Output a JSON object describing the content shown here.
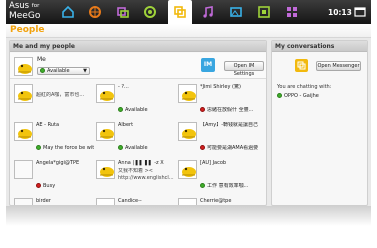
{
  "brand": {
    "line1": "Asus",
    "line1_small": "for",
    "line2": "MeeGo"
  },
  "zones": [
    "home-icon",
    "status-icon",
    "people-icon",
    "games-icon",
    "people-icon",
    "music-icon",
    "photos-icon",
    "web-icon",
    "apps-icon"
  ],
  "clock": "10:13",
  "page_title": "People",
  "left_panel": {
    "title": "Me and my people",
    "me": {
      "name": "Me",
      "status": "Available",
      "open_im_button": "Open IM Settings"
    },
    "contacts": [
      {
        "name": "",
        "message": "超紅的A咖，富市也...",
        "status": "",
        "status_type": "none",
        "avatar": "dino"
      },
      {
        "name": "- ?...",
        "message": "",
        "status": "Available",
        "status_type": "available",
        "avatar": "dino"
      },
      {
        "name": "*Jimi   Shirley (驚)",
        "message": "",
        "status": "思緒在放假什 全豐...",
        "status_type": "busy",
        "avatar": "dino"
      },
      {
        "name": "AE - Ruta",
        "message": "",
        "status": "May the force be wit...",
        "status_type": "available",
        "avatar": "dino"
      },
      {
        "name": "Albert",
        "message": "",
        "status": "Available",
        "status_type": "available",
        "avatar": "dino"
      },
      {
        "name": "【Amy】-轉钱就是讓自己最快找長的捷楼~",
        "message": "",
        "status": "可能要是湖AMA看過要...",
        "status_type": "busy",
        "avatar": "dino"
      },
      {
        "name": "Angela*gigi@TPE",
        "message": "",
        "status": "Busy",
        "status_type": "busy",
        "avatar": "blank"
      },
      {
        "name": "Anna | ▌▌ ▌▌ -z X",
        "message": "又我不知着 >< http://www.englishcl...",
        "status": "",
        "status_type": "none",
        "avatar": "dino"
      },
      {
        "name": "[AU] Jacob",
        "message": "",
        "status": "工作 意有效率咖...",
        "status_type": "available",
        "avatar": "dino"
      },
      {
        "name": "birder",
        "message": "",
        "status": "",
        "status_type": "none",
        "avatar": "blank"
      },
      {
        "name": "Candice--",
        "message": "",
        "status": "",
        "status_type": "none",
        "avatar": "dino"
      },
      {
        "name": "Cherrie@tpe",
        "message": "",
        "status": "",
        "status_type": "none",
        "avatar": "dino"
      }
    ]
  },
  "right_panel": {
    "title": "My conversations",
    "open_messenger_button": "Open Messenger",
    "chatting_label": "You are chatting with:",
    "chatting": [
      {
        "name": "OPPO - Gaijhe",
        "status_type": "available"
      }
    ]
  }
}
